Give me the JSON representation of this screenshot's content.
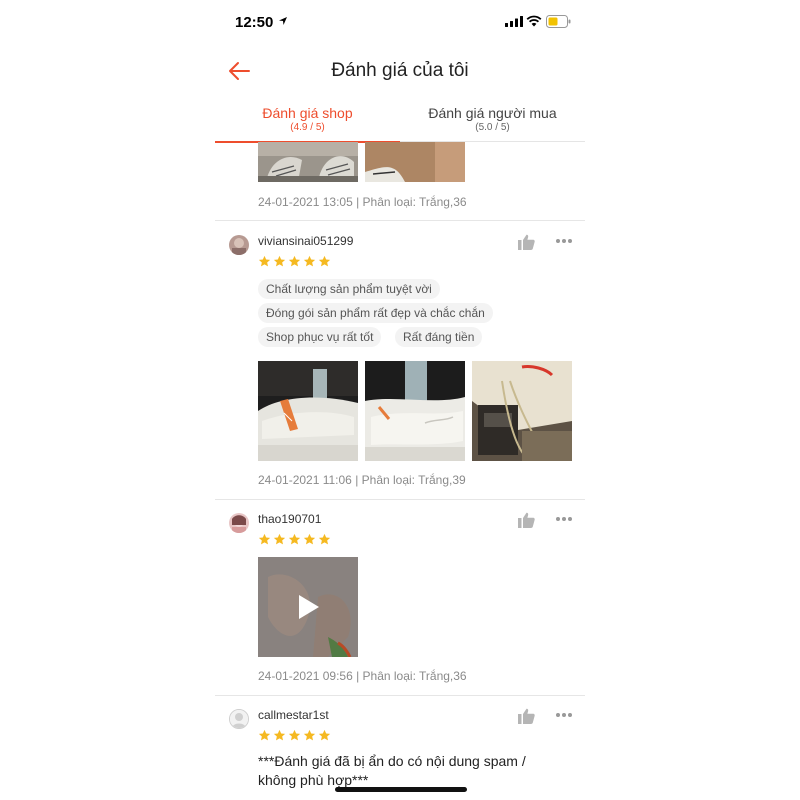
{
  "status": {
    "time": "12:50"
  },
  "header": {
    "title": "Đánh giá của tôi"
  },
  "tabs": [
    {
      "label": "Đánh giá shop",
      "score": "(4.9 / 5)",
      "active": true
    },
    {
      "label": "Đánh giá người mua",
      "score": "(5.0 / 5)",
      "active": false
    }
  ],
  "reviews": [
    {
      "meta": "24-01-2021 13:05 | Phân loại: Trắng,36"
    },
    {
      "username": "viviansinai051299",
      "rating": 5,
      "tags": [
        "Chất lượng sản phẩm tuyệt vời",
        "Đóng gói sản phẩm rất đẹp và chắc chắn",
        "Shop phục vụ rất tốt",
        "Rất đáng tiền"
      ],
      "meta": "24-01-2021 11:06 | Phân loại: Trắng,39"
    },
    {
      "username": "thao190701",
      "rating": 5,
      "meta": "24-01-2021 09:56 | Phân loại: Trắng,36"
    },
    {
      "username": "callmestar1st",
      "rating": 5,
      "hidden_note": "***Đánh giá đã bị ẩn do có nội dung spam / không phù hợp***"
    }
  ],
  "colors": {
    "accent": "#ee4d2d",
    "star": "#f5b921"
  }
}
